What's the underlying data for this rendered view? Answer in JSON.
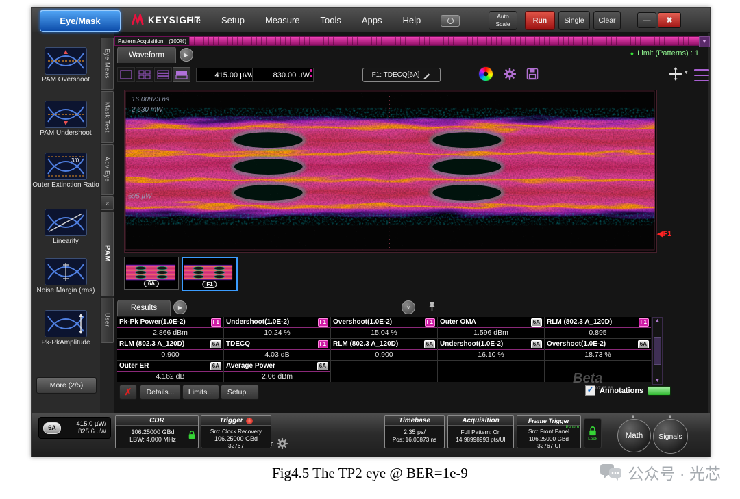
{
  "titlebar": {
    "mode": "Eye/Mask",
    "brand": "KEYSIGHT",
    "menu": [
      "File",
      "Setup",
      "Measure",
      "Tools",
      "Apps",
      "Help"
    ],
    "auto_scale": [
      "Auto",
      "Scale"
    ],
    "run": "Run",
    "single": "Single",
    "clear": "Clear",
    "minimize": "—",
    "close": "✖"
  },
  "sidebar": {
    "items": [
      {
        "label": "PAM Overshoot"
      },
      {
        "label": "PAM Undershoot"
      },
      {
        "label": "Outer Extinction Ratio",
        "icon_text": "3/0"
      },
      {
        "label": "Linearity"
      },
      {
        "label": "Noise Margin (rms)"
      },
      {
        "label": "Pk-PkAmplitude"
      }
    ],
    "more_button": "More (2/5)",
    "tabs": [
      "Eye Meas",
      "Mask Test",
      "Adv Eye",
      "PAM",
      "User"
    ],
    "collapse_button": "«"
  },
  "acquisition_bar": {
    "label": "Pattern Acquisition",
    "percent": "(100%)"
  },
  "waveform": {
    "tab": "Waveform",
    "limit_status": "Limit (Patterns) : 1",
    "scale_per_div": "415.00 µW/",
    "offset": "830.00 µW",
    "source_button": "F1: TDECQ[6A]",
    "annotations": {
      "timebase": "16.00873 ns",
      "power_top": "2.630 mW",
      "power_left": "695 µW"
    },
    "marker": "◀F1",
    "thumbnails": [
      {
        "badge": "6A"
      },
      {
        "badge": "F1"
      }
    ]
  },
  "results": {
    "tab": "Results",
    "cells": [
      {
        "name": "Pk-Pk Power(1.0E-2)",
        "badge": "F1",
        "value": "2.866 dBm"
      },
      {
        "name": "Undershoot(1.0E-2)",
        "badge": "F1",
        "value": "10.24 %"
      },
      {
        "name": "Overshoot(1.0E-2)",
        "badge": "F1",
        "value": "15.04 %"
      },
      {
        "name": "Outer OMA",
        "badge": "6A",
        "value": "1.596 dBm"
      },
      {
        "name": "RLM (802.3 A_120D)",
        "badge": "F1",
        "value": "0.895"
      },
      {
        "name": "RLM (802.3 A_120D)",
        "badge": "6A",
        "value": "0.900"
      },
      {
        "name": "TDECQ",
        "badge": "F1",
        "value": "4.03 dB"
      },
      {
        "name": "RLM (802.3 A_120D)",
        "badge": "6A",
        "value": "0.900"
      },
      {
        "name": "Undershoot(1.0E-2)",
        "badge": "6A",
        "value": "16.10 %"
      },
      {
        "name": "Overshoot(1.0E-2)",
        "badge": "6A",
        "value": "18.73 %"
      },
      {
        "name": "Outer ER",
        "badge": "6A",
        "value": "4.162 dB"
      },
      {
        "name": "Average Power",
        "badge": "6A",
        "value": "2.06 dBm"
      }
    ],
    "buttons": [
      "Details...",
      "Limits...",
      "Setup..."
    ],
    "annotations_label": "Annotations",
    "beta": "Beta",
    "beta_version": "P.07.65.88"
  },
  "statusbar": {
    "channel": {
      "badge": "6A",
      "scale": "415.0 µW/",
      "offset": "825.6 µW"
    },
    "cdr": {
      "title": "CDR",
      "line1": "106.25000 GBd",
      "line2": "LBW: 4.000 MHz"
    },
    "trigger": {
      "title": "Trigger",
      "line1": "Src: Clock Recovery",
      "line2": "106.25000 GBd",
      "line3": "32767",
      "corner": "6"
    },
    "timebase": {
      "title": "Timebase",
      "line1": "2.35 ps/",
      "line2": "Pos: 16.00873 ns"
    },
    "acquisition": {
      "title": "Acquisition",
      "line1": "Full Pattern: On",
      "line2": "14.98998993 pts/UI"
    },
    "frame_trigger": {
      "title": "Frame Trigger",
      "tag": "Pattern",
      "line1": "Src: Front Panel",
      "line2": "106.25000 GBd",
      "line3": "32767 UI"
    },
    "lock_label": "Lock",
    "math_button": "Math",
    "signals_button": "Signals"
  },
  "icons": {
    "bullet": "●",
    "play": "▶",
    "dropdown": "▼",
    "up_arrow": "▲",
    "down_arrow": "▼",
    "collapse_chevron": "∨",
    "warning": "!",
    "check": "✓",
    "cross": "✗"
  },
  "caption": "Fig4.5 The TP2 eye @ BER=1e-9",
  "watermark": "公众号 · 光芯",
  "colors": {
    "accent_magenta": "#cc1f8e",
    "run_red": "#cf2a2a",
    "selection_blue": "#3b9cff",
    "limit_green": "#8ef08e",
    "lock_green": "#35d435"
  }
}
